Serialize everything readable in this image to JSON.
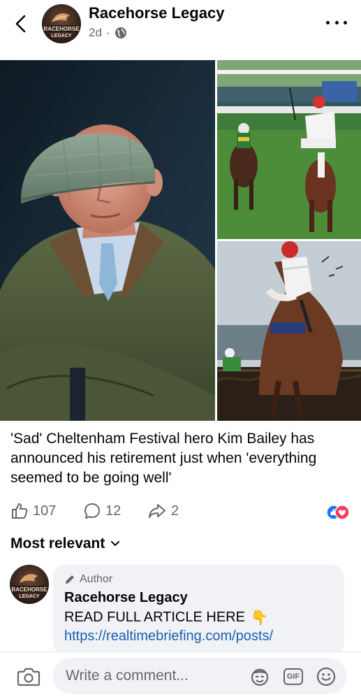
{
  "header": {
    "page_name": "Racehorse Legacy",
    "time_ago": "2d",
    "separator": "·",
    "avatar_text": "RACEHORSE LEGACY",
    "back_icon": "chevron-left-icon",
    "privacy_icon": "globe-icon",
    "more_icon": "more-horizontal-icon"
  },
  "post": {
    "caption": "'Sad' Cheltenham Festival hero Kim Bailey has announced his retirement just when 'everything seemed to be going well'"
  },
  "reactions": {
    "likes": "107",
    "comments": "12",
    "shares": "2",
    "reaction_icons": [
      "like-reaction-icon",
      "love-reaction-icon"
    ],
    "like_color": "#1877f2",
    "love_color": "#f33e58"
  },
  "comments_section": {
    "sort_label": "Most relevant",
    "first_comment": {
      "badge": "Author",
      "name": "Racehorse Legacy",
      "text": "READ FULL ARTICLE HERE",
      "text_emoji": "👇",
      "link": "https://realtimebriefing.com/posts/"
    }
  },
  "composer": {
    "placeholder": "Write a comment...",
    "gif_label": "GIF",
    "icons": [
      "camera-icon",
      "avatar-sticker-icon",
      "gif-icon",
      "emoji-icon"
    ]
  }
}
